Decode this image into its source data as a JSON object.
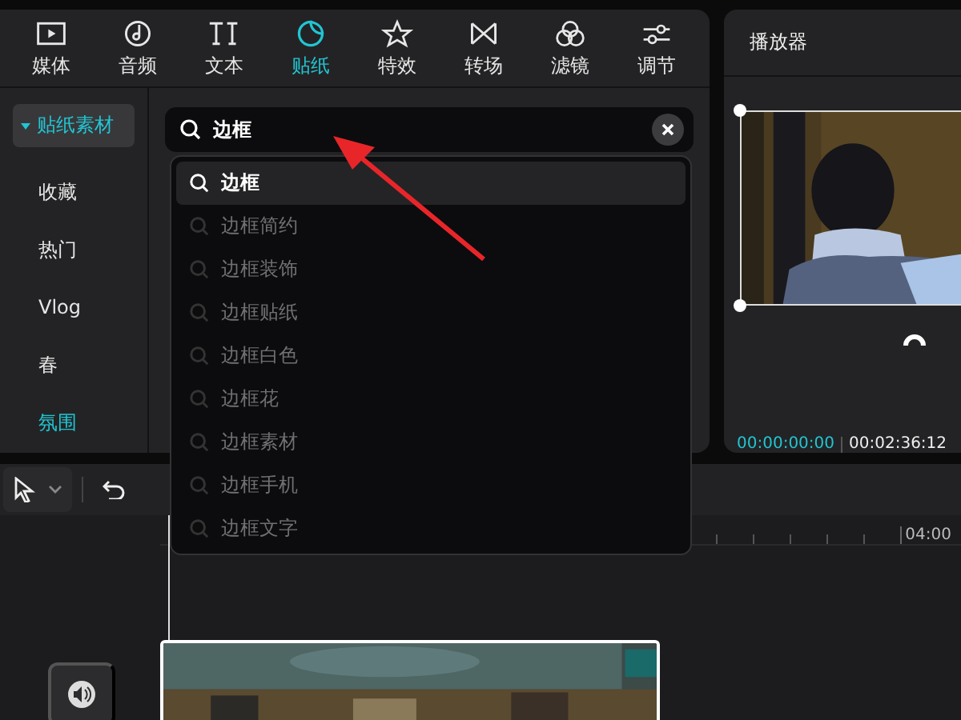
{
  "tabs": [
    {
      "label": "媒体",
      "selected": false,
      "kind": "media"
    },
    {
      "label": "音频",
      "selected": false,
      "kind": "audio"
    },
    {
      "label": "文本",
      "selected": false,
      "kind": "text"
    },
    {
      "label": "贴纸",
      "selected": true,
      "kind": "sticker"
    },
    {
      "label": "特效",
      "selected": false,
      "kind": "effect"
    },
    {
      "label": "转场",
      "selected": false,
      "kind": "transition"
    },
    {
      "label": "滤镜",
      "selected": false,
      "kind": "filter"
    },
    {
      "label": "调节",
      "selected": false,
      "kind": "adjust"
    }
  ],
  "sidebar": {
    "items": [
      {
        "label": "贴纸素材",
        "kind": "category",
        "expanded": true,
        "selected": true
      },
      {
        "label": "收藏",
        "kind": "item",
        "selected": false
      },
      {
        "label": "热门",
        "kind": "item",
        "selected": false
      },
      {
        "label": "Vlog",
        "kind": "item",
        "selected": false
      },
      {
        "label": "春",
        "kind": "item",
        "selected": false
      },
      {
        "label": "氛围",
        "kind": "item",
        "selected": true
      }
    ]
  },
  "search": {
    "value": "边框"
  },
  "suggestions": [
    {
      "label": "边框",
      "selected": true
    },
    {
      "label": "边框简约",
      "selected": false
    },
    {
      "label": "边框装饰",
      "selected": false
    },
    {
      "label": "边框贴纸",
      "selected": false
    },
    {
      "label": "边框白色",
      "selected": false
    },
    {
      "label": "边框花",
      "selected": false
    },
    {
      "label": "边框素材",
      "selected": false
    },
    {
      "label": "边框手机",
      "selected": false
    },
    {
      "label": "边框文字",
      "selected": false
    }
  ],
  "player": {
    "title": "播放器",
    "current_time": "00:00:00:00",
    "total_time": "00:02:36:12"
  },
  "timeline": {
    "ruler_label": "04:00"
  }
}
